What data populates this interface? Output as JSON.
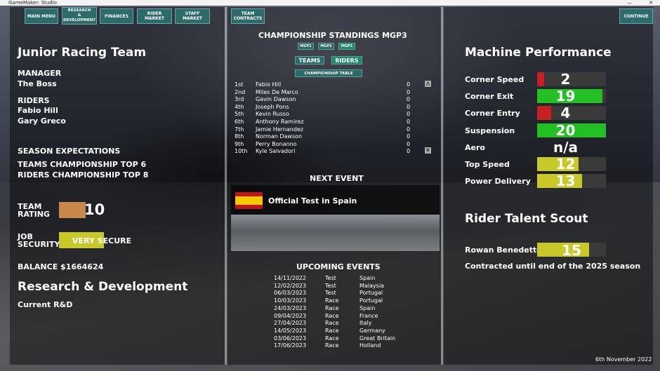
{
  "window": {
    "title": "GameMaker: Studio",
    "minimize": "—",
    "close": "✕"
  },
  "nav": {
    "main_menu": "MAIN MENU",
    "research": "RESEARCH\n&\nDEVELOPMENT",
    "finances": "FINANCES",
    "rider_market": "RIDER MARKET",
    "staff_market": "STAFF MARKET",
    "team_contracts": "TEAM\nCONTRACTS",
    "continue": "CONTINUE"
  },
  "team": {
    "name": "Junior Racing Team",
    "manager_label": "MANAGER",
    "manager": "The Boss",
    "riders_label": "RIDERS",
    "riders": [
      "Fabio Hill",
      "Gary Greco"
    ],
    "expectations_label": "SEASON EXPECTATIONS",
    "teams_expectation": "TEAMS CHAMPIONSHIP  TOP 6",
    "riders_expectation": "RIDERS CHAMPIONSHIP TOP 8",
    "rating_label": "TEAM\nRATING",
    "rating": "10",
    "rating_fraction": 0.4,
    "rating_color": "#c8884a",
    "job_label": "JOB\nSECURITY",
    "job_value": "VERY SECURE",
    "job_color": "#c8c82a",
    "balance": "BALANCE $1664624",
    "rd_title": "Research & Development",
    "rd_current": "Current R&D"
  },
  "standings": {
    "title": "CHAMPIONSHIP STANDINGS MGP3",
    "classes": [
      "MGP1",
      "MGP2",
      "MGP3"
    ],
    "tabs": [
      "TEAMS",
      "RIDERS"
    ],
    "table_button": "CHAMPIONSHIP TABLE",
    "up": "⋀",
    "down": "V",
    "rows": [
      {
        "pos": "1st",
        "name": "Fabio Hill",
        "pts": "0"
      },
      {
        "pos": "2nd",
        "name": "Miles De Marco",
        "pts": "0"
      },
      {
        "pos": "3rd",
        "name": "Gavin Dawson",
        "pts": "0"
      },
      {
        "pos": "4th",
        "name": "Joseph Pons",
        "pts": "0"
      },
      {
        "pos": "5th",
        "name": "Kevin Russo",
        "pts": "0"
      },
      {
        "pos": "6th",
        "name": "Anthony Ramirez",
        "pts": "0"
      },
      {
        "pos": "7th",
        "name": "Jamie Hernandez",
        "pts": "0"
      },
      {
        "pos": "8th",
        "name": "Norman Dawson",
        "pts": "0"
      },
      {
        "pos": "9th",
        "name": "Perry Bonanno",
        "pts": "0"
      },
      {
        "pos": "10th",
        "name": "Kyle Salvadori",
        "pts": "0"
      }
    ]
  },
  "next_event": {
    "label": "NEXT EVENT",
    "name": "Official Test in  Spain",
    "flag": "spain-flag"
  },
  "upcoming": {
    "label": "UPCOMING EVENTS",
    "rows": [
      {
        "date": "14/11/2022",
        "type": "Test",
        "place": "Spain"
      },
      {
        "date": "12/02/2023",
        "type": "Test",
        "place": "Malaysia"
      },
      {
        "date": "06/03/2023",
        "type": "Test",
        "place": "Portugal"
      },
      {
        "date": "10/03/2023",
        "type": "Race",
        "place": "Portugal"
      },
      {
        "date": "24/03/2023",
        "type": "Race",
        "place": "Spain"
      },
      {
        "date": "09/04/2023",
        "type": "Race",
        "place": "France"
      },
      {
        "date": "27/04/2023",
        "type": "Race",
        "place": "Italy"
      },
      {
        "date": "14/05/2023",
        "type": "Race",
        "place": "Germany"
      },
      {
        "date": "03/06/2023",
        "type": "Race",
        "place": "Great Britain"
      },
      {
        "date": "17/06/2023",
        "type": "Race",
        "place": "Holland"
      }
    ]
  },
  "machine": {
    "title": "Machine Performance",
    "stats": [
      {
        "label": "Corner Speed",
        "value": "2",
        "fraction": 0.1,
        "color": "#c82020"
      },
      {
        "label": "Corner Exit",
        "value": "19",
        "fraction": 0.95,
        "color": "#22c022"
      },
      {
        "label": "Corner Entry",
        "value": "4",
        "fraction": 0.2,
        "color": "#c82020"
      },
      {
        "label": "Suspension",
        "value": "20",
        "fraction": 1.0,
        "color": "#22c022"
      },
      {
        "label": "Aero",
        "value": "n/a",
        "fraction": 0,
        "color": "#3a3a3a"
      },
      {
        "label": "Top Speed",
        "value": "12",
        "fraction": 0.6,
        "color": "#c8c82a"
      },
      {
        "label": "Power Delivery",
        "value": "13",
        "fraction": 0.65,
        "color": "#c8c82a"
      }
    ]
  },
  "scout": {
    "title": "Rider Talent Scout",
    "rider": "Rowan Benedetto",
    "value": "15",
    "fraction": 0.75,
    "color": "#c8c82a",
    "contract": "Contracted until end of the 2025 season"
  },
  "date": "6th November 2022"
}
